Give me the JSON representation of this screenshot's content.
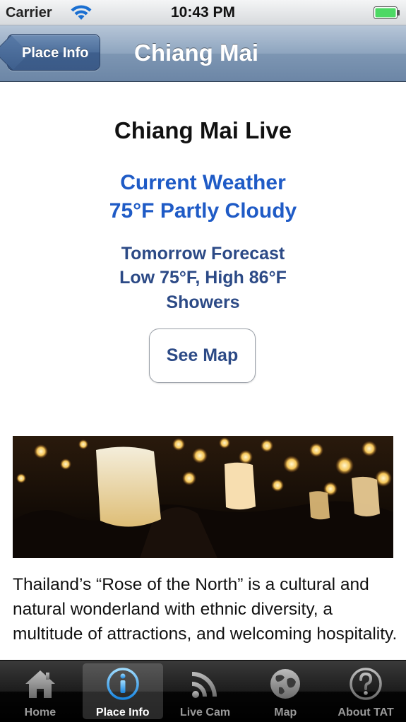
{
  "status_bar": {
    "carrier": "Carrier",
    "time": "10:43 PM",
    "battery_color": "#4cd964"
  },
  "nav": {
    "back_label": "Place Info",
    "title": "Chiang Mai"
  },
  "content": {
    "live_title": "Chiang Mai Live",
    "current_weather": {
      "heading": "Current Weather",
      "value": "75°F Partly Cloudy"
    },
    "forecast": {
      "heading": "Tomorrow Forecast",
      "range": "Low 75°F, High 86°F",
      "condition": "Showers"
    },
    "map_button": "See Map",
    "photo_icon": "lantern-festival-photo",
    "description": "Thailand’s “Rose of the North” is a cultural and natural wonderland with ethnic diversity, a multitude of attractions, and welcoming hospitality."
  },
  "tab_bar": {
    "selected": "Place Info",
    "tabs": [
      {
        "label": "Home",
        "icon": "home-icon"
      },
      {
        "label": "Place Info",
        "icon": "info-icon"
      },
      {
        "label": "Live Cam",
        "icon": "rss-icon"
      },
      {
        "label": "Map",
        "icon": "globe-icon"
      },
      {
        "label": "About TAT",
        "icon": "question-icon"
      }
    ]
  },
  "colors": {
    "link_blue": "#1f5bc6",
    "forecast_blue": "#2c4a86",
    "nav_bar": "#7d96b3"
  }
}
